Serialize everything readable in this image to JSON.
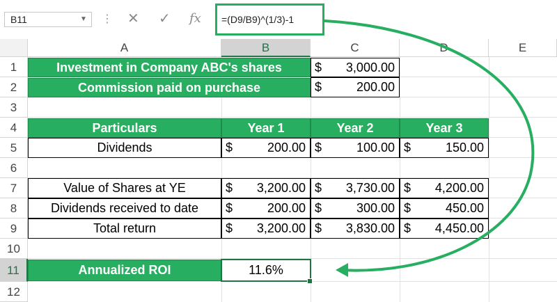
{
  "name_box": {
    "value": "B11"
  },
  "formula_bar": {
    "value": "=(D9/B9)^(1/3)-1"
  },
  "icons": {
    "cancel": "close-icon",
    "enter": "check-icon",
    "function": "fx-icon"
  },
  "columns": [
    "A",
    "B",
    "C",
    "D",
    "E"
  ],
  "rows": [
    "1",
    "2",
    "3",
    "4",
    "5",
    "6",
    "7",
    "8",
    "9",
    "10",
    "11",
    "12"
  ],
  "colors": {
    "accent": "#27ae60",
    "selection": "#217346"
  },
  "cells": {
    "A1": "Investment in Company ABC's shares",
    "C1_cur": "$",
    "C1_amt": "3,000.00",
    "A2": "Commission paid on purchase",
    "C2_cur": "$",
    "C2_amt": "200.00",
    "A4": "Particulars",
    "B4": "Year 1",
    "C4": "Year 2",
    "D4": "Year 3",
    "A5": "Dividends",
    "B5_cur": "$",
    "B5_amt": "200.00",
    "C5_cur": "$",
    "C5_amt": "100.00",
    "D5_cur": "$",
    "D5_amt": "150.00",
    "A7": "Value of Shares at YE",
    "B7_cur": "$",
    "B7_amt": "3,200.00",
    "C7_cur": "$",
    "C7_amt": "3,730.00",
    "D7_cur": "$",
    "D7_amt": "4,200.00",
    "A8": "Dividends received to date",
    "B8_cur": "$",
    "B8_amt": "200.00",
    "C8_cur": "$",
    "C8_amt": "300.00",
    "D8_cur": "$",
    "D8_amt": "450.00",
    "A9": "Total return",
    "B9_cur": "$",
    "B9_amt": "3,200.00",
    "C9_cur": "$",
    "C9_amt": "3,830.00",
    "D9_cur": "$",
    "D9_amt": "4,450.00",
    "A11": "Annualized ROI",
    "B11": "11.6%"
  }
}
